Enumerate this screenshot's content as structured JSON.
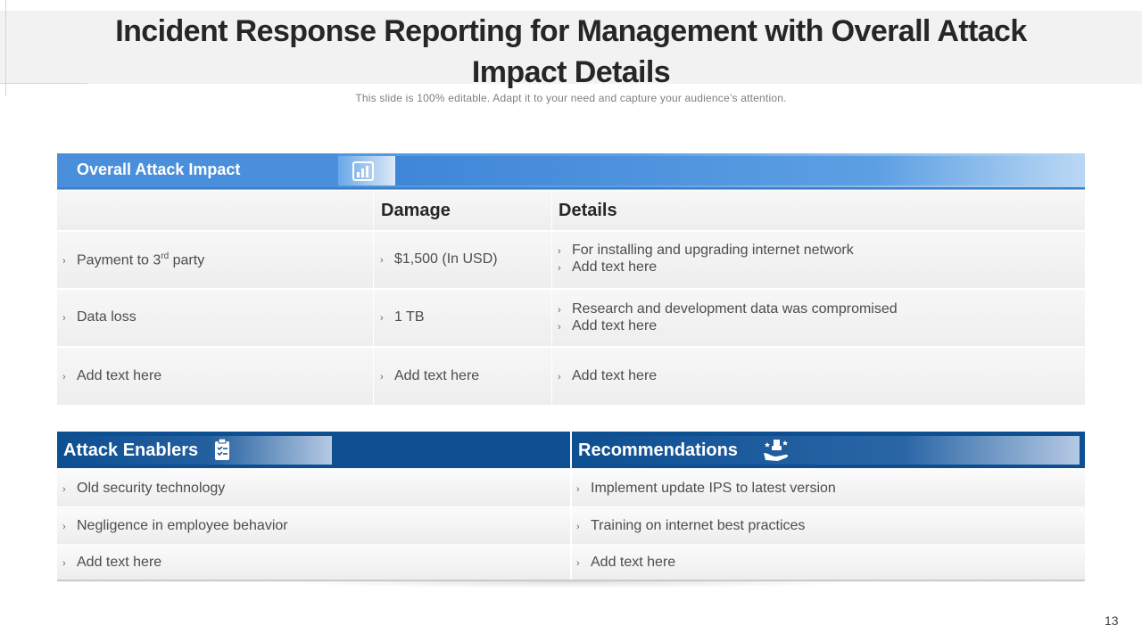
{
  "slide": {
    "title": "Incident Response Reporting for Management with Overall Attack Impact Details",
    "subtitle": "This slide is 100% editable. Adapt it to your need and capture your audience’s attention.",
    "page_number": "13"
  },
  "impact": {
    "header": "Overall Attack Impact",
    "header_icon": "bar-chart-icon",
    "columns": {
      "damage": "Damage",
      "details": "Details"
    },
    "rows": [
      {
        "item_pre": "Payment to 3",
        "item_sup": "rd",
        "item_post": " party",
        "damage": "$1,500 (In USD)",
        "details": [
          "For installing and upgrading internet network",
          "Add text here"
        ]
      },
      {
        "item": "Data loss",
        "damage": "1 TB",
        "details": [
          "Research and development data was compromised",
          "Add text here"
        ]
      },
      {
        "item": "Add text here",
        "damage": "Add text here",
        "details": [
          "Add text here"
        ]
      }
    ]
  },
  "enablers": {
    "header": "Attack Enablers",
    "icon": "clipboard-checklist-icon",
    "items": [
      "Old security technology",
      "Negligence  in employee behavior",
      "Add text here"
    ]
  },
  "recommendations": {
    "header": "Recommendations",
    "icon": "hand-stars-icon",
    "items": [
      "Implement  update IPS to latest version",
      "Training on internet best practices",
      "Add text here"
    ]
  },
  "colors": {
    "impact_header": "#4a8fdb",
    "band_dark_blue": "#0e4f92",
    "row_gray": "#efefef"
  },
  "bullet_glyph": "›"
}
